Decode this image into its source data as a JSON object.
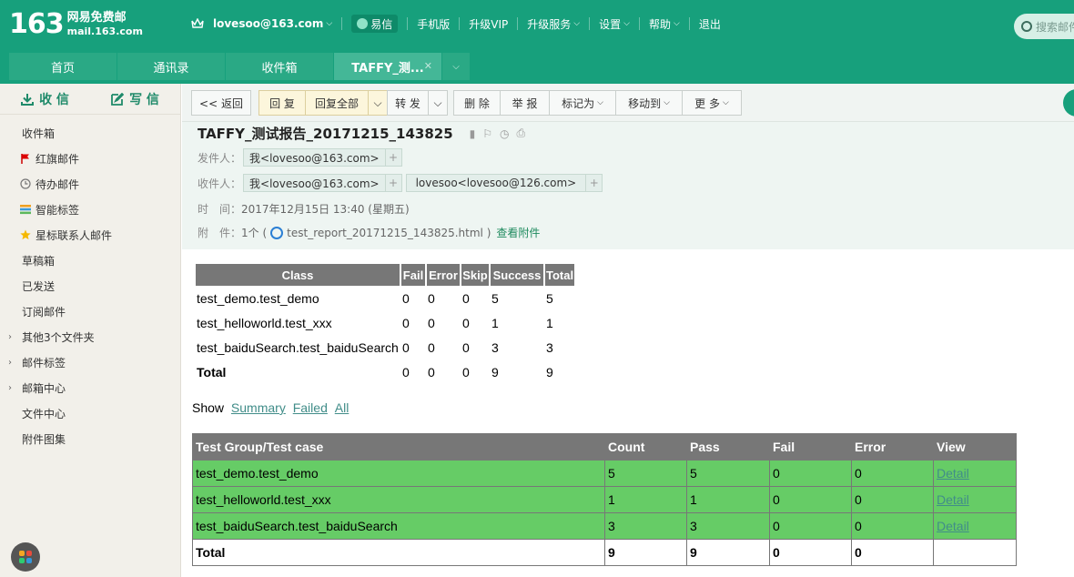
{
  "header": {
    "logo_num": "163",
    "logo_cn": "网易免费邮",
    "logo_domain": "mail.163.com",
    "user": "lovesoo@163.com",
    "nav": [
      "易信",
      "手机版",
      "升级VIP",
      "升级服务",
      "设置",
      "帮助",
      "退出"
    ],
    "search_placeholder": "搜索邮件"
  },
  "tabs": [
    "首页",
    "通讯录",
    "收件箱",
    "TAFFY_测..."
  ],
  "sidebar": {
    "receive": "收 信",
    "write": "写 信",
    "items": [
      "收件箱",
      "红旗邮件",
      "待办邮件",
      "智能标签",
      "星标联系人邮件",
      "草稿箱",
      "已发送",
      "订阅邮件",
      "其他3个文件夹",
      "邮件标签",
      "邮箱中心",
      "文件中心",
      "附件图集"
    ]
  },
  "toolbar": {
    "back": "<< 返回",
    "reply": "回 复",
    "reply_all": "回复全部",
    "forward": "转 发",
    "delete": "删 除",
    "report": "举 报",
    "mark": "标记为",
    "move": "移动到",
    "more": "更 多"
  },
  "mail": {
    "subject": "TAFFY_测试报告_20171215_143825",
    "from_label": "发件人：",
    "from": "我<lovesoo@163.com>",
    "to_label": "收件人：",
    "to": [
      "我<lovesoo@163.com>",
      "lovesoo<lovesoo@126.com>"
    ],
    "time_label": "时　间：",
    "time": "2017年12月15日 13:40 (星期五)",
    "attach_label": "附　件：",
    "attach_count": "1个 (",
    "attach_file": "test_report_20171215_143825.html )",
    "view_attach": "查看附件"
  },
  "summary": {
    "headers": [
      "Class",
      "Fail",
      "Error",
      "Skip",
      "Success",
      "Total"
    ],
    "rows": [
      [
        "test_demo.test_demo",
        "0",
        "0",
        "0",
        "5",
        "5"
      ],
      [
        "test_helloworld.test_xxx",
        "0",
        "0",
        "0",
        "1",
        "1"
      ],
      [
        "test_baiduSearch.test_baiduSearch",
        "0",
        "0",
        "0",
        "3",
        "3"
      ],
      [
        "Total",
        "0",
        "0",
        "0",
        "9",
        "9"
      ]
    ]
  },
  "show": {
    "label": "Show",
    "links": [
      "Summary",
      "Failed",
      "All"
    ]
  },
  "detail": {
    "headers": [
      "Test Group/Test case",
      "Count",
      "Pass",
      "Fail",
      "Error",
      "View"
    ],
    "rows": [
      [
        "test_demo.test_demo",
        "5",
        "5",
        "0",
        "0",
        "Detail"
      ],
      [
        "test_helloworld.test_xxx",
        "1",
        "1",
        "0",
        "0",
        "Detail"
      ],
      [
        "test_baiduSearch.test_baiduSearch",
        "3",
        "3",
        "0",
        "0",
        "Detail"
      ]
    ],
    "total": [
      "Total",
      "9",
      "9",
      "0",
      "0",
      ""
    ]
  },
  "colors": {
    "brand": "#17a07c",
    "pass_row": "#66cc66",
    "header_gray": "#777777"
  }
}
